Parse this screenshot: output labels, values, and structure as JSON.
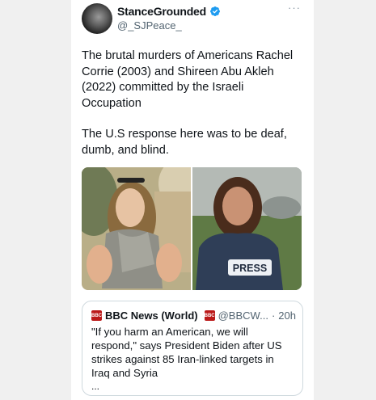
{
  "tweet": {
    "display_name": "StanceGrounded",
    "handle": "@_SJPeace_",
    "paragraphs": [
      "The brutal murders of Americans Rachel Corrie (2003) and Shireen Abu Akleh (2022) committed by the Israeli Occupation",
      "The U.S response here was to be deaf, dumb, and blind."
    ],
    "more_glyph": "···",
    "media": {
      "press_text": "PRESS"
    }
  },
  "quote": {
    "name": "BBC News (World)",
    "handle": "@BBCW...",
    "separator": "·",
    "time": "20h",
    "logo_text": "BBC",
    "text": "\"If you harm an American, we will respond,\" says President Biden after US strikes against 85 Iran-linked targets in Iraq and Syria",
    "ellipsis": "..."
  },
  "colors": {
    "verified": "#1d9bf0",
    "gold_badge": "#e2b719",
    "bbc_red": "#bb1919",
    "muted_text": "#536471"
  }
}
